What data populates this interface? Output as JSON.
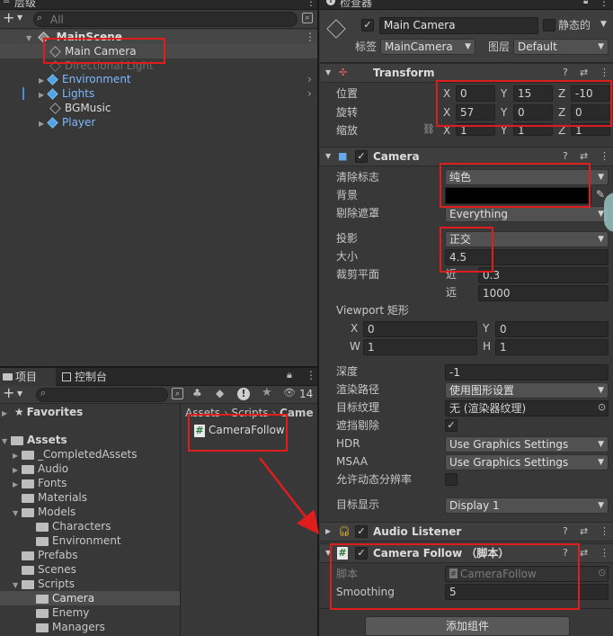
{
  "hierarchy": {
    "title": "层级",
    "search_placeholder": "All",
    "scene": "MainScene",
    "items": [
      "Main Camera",
      "Directional Light",
      "Environment",
      "Lights",
      "BGMusic",
      "Player"
    ]
  },
  "inspector": {
    "title": "检查器",
    "object_name": "Main Camera",
    "static_label": "静态的",
    "tag_label": "标签",
    "tag_value": "MainCamera",
    "layer_label": "图层",
    "layer_value": "Default"
  },
  "transform": {
    "title": "Transform",
    "position_label": "位置",
    "rotation_label": "旋转",
    "scale_label": "缩放",
    "axis_x": "X",
    "axis_y": "Y",
    "axis_z": "Z",
    "position": [
      "0",
      "15",
      "-10"
    ],
    "rotation": [
      "57",
      "0",
      "0"
    ],
    "scale": [
      "1",
      "1",
      "1"
    ]
  },
  "camera": {
    "title": "Camera",
    "clear_flags_label": "清除标志",
    "clear_flags_value": "纯色",
    "background_label": "背景",
    "background_color": "#000000",
    "culling_mask_label": "剔除遮罩",
    "culling_mask_value": "Everything",
    "projection_label": "投影",
    "projection_value": "正交",
    "size_label": "大小",
    "size_value": "4.5",
    "clipping_label": "裁剪平面",
    "near_label": "近",
    "near_value": "0.3",
    "far_label": "远",
    "far_value": "1000",
    "viewport_label": "Viewport 矩形",
    "vp_x_label": "X",
    "vp_x": "0",
    "vp_y_label": "Y",
    "vp_y": "0",
    "vp_w_label": "W",
    "vp_w": "1",
    "vp_h_label": "H",
    "vp_h": "1",
    "depth_label": "深度",
    "depth_value": "-1",
    "render_path_label": "渲染路径",
    "render_path_value": "使用图形设置",
    "target_texture_label": "目标纹理",
    "target_texture_value": "无 (渲染器纹理)",
    "occlusion_label": "遮挡剔除",
    "hdr_label": "HDR",
    "hdr_value": "Use Graphics Settings",
    "msaa_label": "MSAA",
    "msaa_value": "Use Graphics Settings",
    "dynamic_res_label": "允许动态分辨率",
    "target_display_label": "目标显示",
    "target_display_value": "Display 1"
  },
  "audio_listener": {
    "title": "Audio Listener"
  },
  "camera_follow": {
    "title": "Camera Follow （脚本）",
    "script_label": "脚本",
    "script_value": "CameraFollow",
    "smoothing_label": "Smoothing",
    "smoothing_value": "5"
  },
  "add_component_label": "添加组件",
  "project": {
    "tab_project": "项目",
    "tab_console": "控制台",
    "badge_count": "14",
    "favorites": "Favorites",
    "assets": "Assets",
    "folders": [
      "_CompletedAssets",
      "Audio",
      "Fonts",
      "Materials",
      "Models",
      "Characters",
      "Environment",
      "Prefabs",
      "Scenes",
      "Scripts",
      "Camera",
      "Enemy",
      "Managers"
    ],
    "breadcrumb": [
      "Assets",
      "Scripts",
      "Came"
    ],
    "file": "CameraFollow"
  },
  "colors": {
    "highlight": "#e01d1d",
    "selected": "#2c5d87",
    "prefab_blue": "#7fb8ff"
  }
}
